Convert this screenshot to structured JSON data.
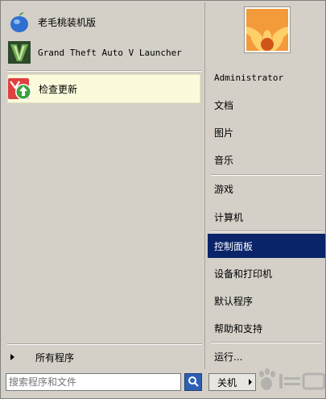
{
  "programs": [
    {
      "label": "老毛桃装机版",
      "icon": "peach-icon"
    },
    {
      "label": "Grand Theft Auto V Launcher",
      "icon": "gta-v-icon"
    },
    {
      "label": "检查更新",
      "icon": "update-arrow-icon"
    }
  ],
  "all_programs_label": "所有程序",
  "search": {
    "value": "",
    "placeholder": "搜索程序和文件"
  },
  "right_items": {
    "username": "Administrator",
    "documents": "文档",
    "pictures": "图片",
    "music": "音乐",
    "games": "游戏",
    "computer": "计算机",
    "control_panel": "控制面板",
    "devices_printers": "设备和打印机",
    "default_programs": "默认程序",
    "help_support": "帮助和支持",
    "run": "运行..."
  },
  "shutdown_label": "关机",
  "colors": {
    "menu_bg": "#d4d0c8",
    "selected_bg": "#0a246a",
    "highlight_bg": "#fbfbdc"
  }
}
